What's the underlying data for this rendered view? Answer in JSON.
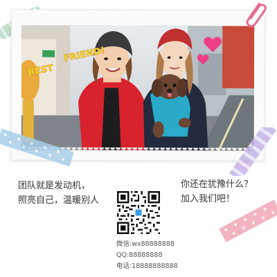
{
  "photo": {
    "caption": "BEST FRIEND!"
  },
  "slogan": {
    "line1": "团队就是发动机，",
    "line2": "照亮自己，温暖别人"
  },
  "ask": {
    "line1": "你还在犹豫什么？",
    "line2": "加入我们吧！"
  },
  "contacts": {
    "wechat": "微信:wx88888888",
    "qq": "QQ:88888888",
    "phone": "电话:18888888888"
  },
  "colors": {
    "tape_blue": "#a9cfe8",
    "tape_pink": "#f2a7b8",
    "tape_purple": "#c5b3e6",
    "tape_green": "#b7d9c1",
    "caption_yellow": "#f5e22a",
    "heart_pink": "#ee3f86"
  },
  "icons": {
    "paperclip": "paperclip-icon",
    "qr": "qr-code"
  }
}
